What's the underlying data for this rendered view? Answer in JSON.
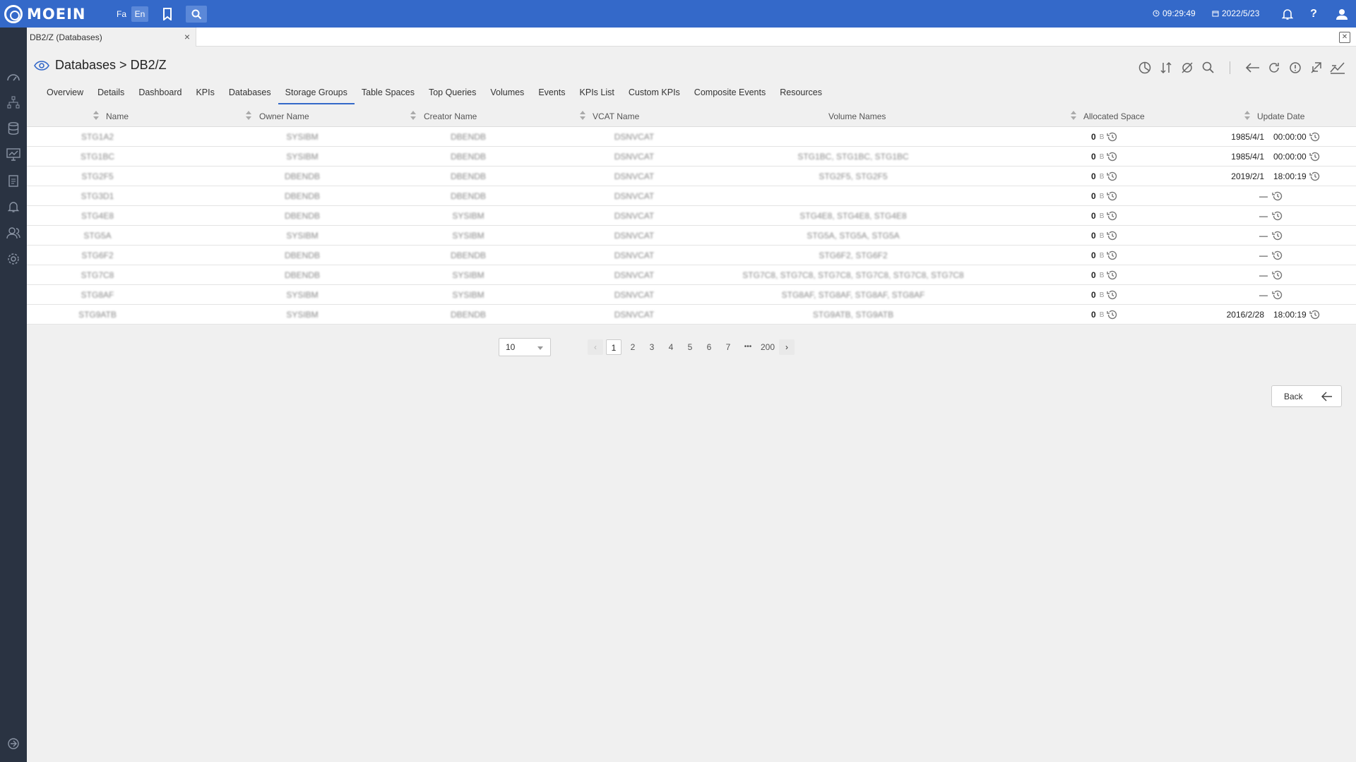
{
  "app": {
    "logo_text": "MOEIN",
    "lang_fa": "Fa",
    "lang_en": "En",
    "time": "09:29:49",
    "date": "2022/5/23"
  },
  "doc_tab": {
    "label": "DB2/Z (Databases)",
    "close": "×"
  },
  "breadcrumb": "Databases > DB2/Z",
  "tabs": [
    "Overview",
    "Details",
    "Dashboard",
    "KPIs",
    "Databases",
    "Storage Groups",
    "Table Spaces",
    "Top Queries",
    "Volumes",
    "Events",
    "KPIs List",
    "Custom KPIs",
    "Composite Events",
    "Resources"
  ],
  "active_tab": "Storage Groups",
  "columns": {
    "name": "Name",
    "owner": "Owner Name",
    "creator": "Creator Name",
    "vcat": "VCAT Name",
    "volumes": "Volume Names",
    "allocated": "Allocated Space",
    "updated": "Update Date"
  },
  "rows": [
    {
      "name": "STG1A2",
      "owner": "SYSIBM",
      "creator": "DBENDB",
      "vcat": "DSNVCAT",
      "volumes": "",
      "alloc": "0",
      "unit": "B",
      "date": "1985/4/1",
      "time": "00:00:00"
    },
    {
      "name": "STG1BC",
      "owner": "SYSIBM",
      "creator": "DBENDB",
      "vcat": "DSNVCAT",
      "volumes": "STG1BC, STG1BC, STG1BC",
      "alloc": "0",
      "unit": "B",
      "date": "1985/4/1",
      "time": "00:00:00"
    },
    {
      "name": "STG2F5",
      "owner": "DBENDB",
      "creator": "DBENDB",
      "vcat": "DSNVCAT",
      "volumes": "STG2F5, STG2F5",
      "alloc": "0",
      "unit": "B",
      "date": "2019/2/1",
      "time": "18:00:19"
    },
    {
      "name": "STG3D1",
      "owner": "DBENDB",
      "creator": "DBENDB",
      "vcat": "DSNVCAT",
      "volumes": "",
      "alloc": "0",
      "unit": "B",
      "date": "—",
      "time": ""
    },
    {
      "name": "STG4E8",
      "owner": "DBENDB",
      "creator": "SYSIBM",
      "vcat": "DSNVCAT",
      "volumes": "STG4E8, STG4E8, STG4E8",
      "alloc": "0",
      "unit": "B",
      "date": "—",
      "time": ""
    },
    {
      "name": "STG5A",
      "owner": "SYSIBM",
      "creator": "SYSIBM",
      "vcat": "DSNVCAT",
      "volumes": "STG5A, STG5A, STG5A",
      "alloc": "0",
      "unit": "B",
      "date": "—",
      "time": ""
    },
    {
      "name": "STG6F2",
      "owner": "DBENDB",
      "creator": "DBENDB",
      "vcat": "DSNVCAT",
      "volumes": "STG6F2, STG6F2",
      "alloc": "0",
      "unit": "B",
      "date": "—",
      "time": ""
    },
    {
      "name": "STG7C8",
      "owner": "DBENDB",
      "creator": "SYSIBM",
      "vcat": "DSNVCAT",
      "volumes": "STG7C8, STG7C8, STG7C8, STG7C8, STG7C8, STG7C8",
      "alloc": "0",
      "unit": "B",
      "date": "—",
      "time": ""
    },
    {
      "name": "STG8AF",
      "owner": "SYSIBM",
      "creator": "SYSIBM",
      "vcat": "DSNVCAT",
      "volumes": "STG8AF, STG8AF, STG8AF, STG8AF",
      "alloc": "0",
      "unit": "B",
      "date": "—",
      "time": ""
    },
    {
      "name": "STG9ATB",
      "owner": "SYSIBM",
      "creator": "DBENDB",
      "vcat": "DSNVCAT",
      "volumes": "STG9ATB, STG9ATB",
      "alloc": "0",
      "unit": "B",
      "date": "2016/2/28",
      "time": "18:00:19"
    }
  ],
  "pagination": {
    "page_size": "10",
    "pages": [
      "1",
      "2",
      "3",
      "4",
      "5",
      "6",
      "7",
      "•••",
      "200"
    ],
    "current": "1"
  },
  "back_label": "Back",
  "colors": {
    "topbar": "#3469c9",
    "sidebar": "#2a3342",
    "accent": "#3469c9"
  }
}
